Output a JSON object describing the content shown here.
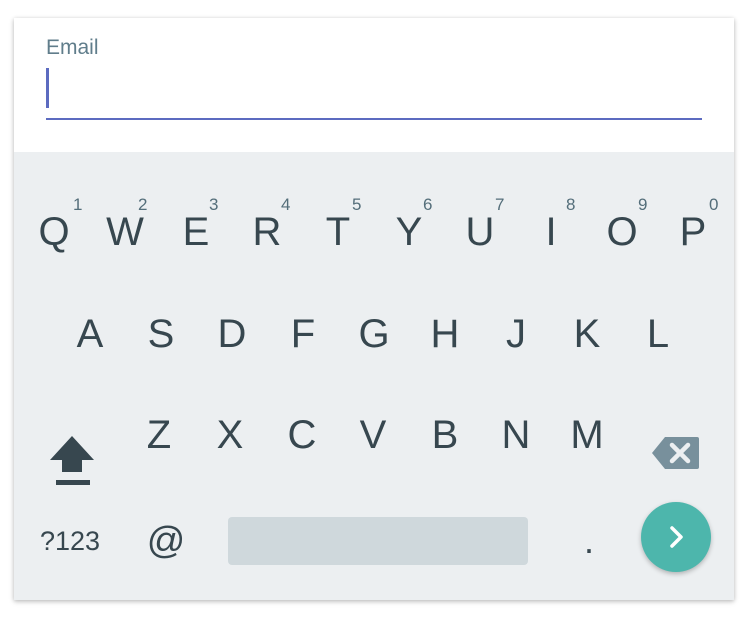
{
  "field": {
    "label": "Email",
    "value": ""
  },
  "keyboard": {
    "row1": [
      {
        "key": "Q",
        "hint": "1"
      },
      {
        "key": "W",
        "hint": "2"
      },
      {
        "key": "E",
        "hint": "3"
      },
      {
        "key": "R",
        "hint": "4"
      },
      {
        "key": "T",
        "hint": "5"
      },
      {
        "key": "Y",
        "hint": "6"
      },
      {
        "key": "U",
        "hint": "7"
      },
      {
        "key": "I",
        "hint": "8"
      },
      {
        "key": "O",
        "hint": "9"
      },
      {
        "key": "P",
        "hint": "0"
      }
    ],
    "row2": [
      "A",
      "S",
      "D",
      "F",
      "G",
      "H",
      "J",
      "K",
      "L"
    ],
    "row3": [
      "Z",
      "X",
      "C",
      "V",
      "B",
      "N",
      "M"
    ],
    "bottom": {
      "symbols_label": "?123",
      "at_label": "@",
      "period_label": "."
    },
    "icons": {
      "shift": "shift-icon",
      "backspace": "backspace-icon",
      "enter": "chevron-right-icon"
    }
  },
  "colors": {
    "accent": "#5c6bc0",
    "keyboard_bg": "#eceff1",
    "key_text": "#37474f",
    "enter_bg": "#4db6ac",
    "space_bg": "#cfd8dc",
    "backspace_fill": "#78909c"
  }
}
